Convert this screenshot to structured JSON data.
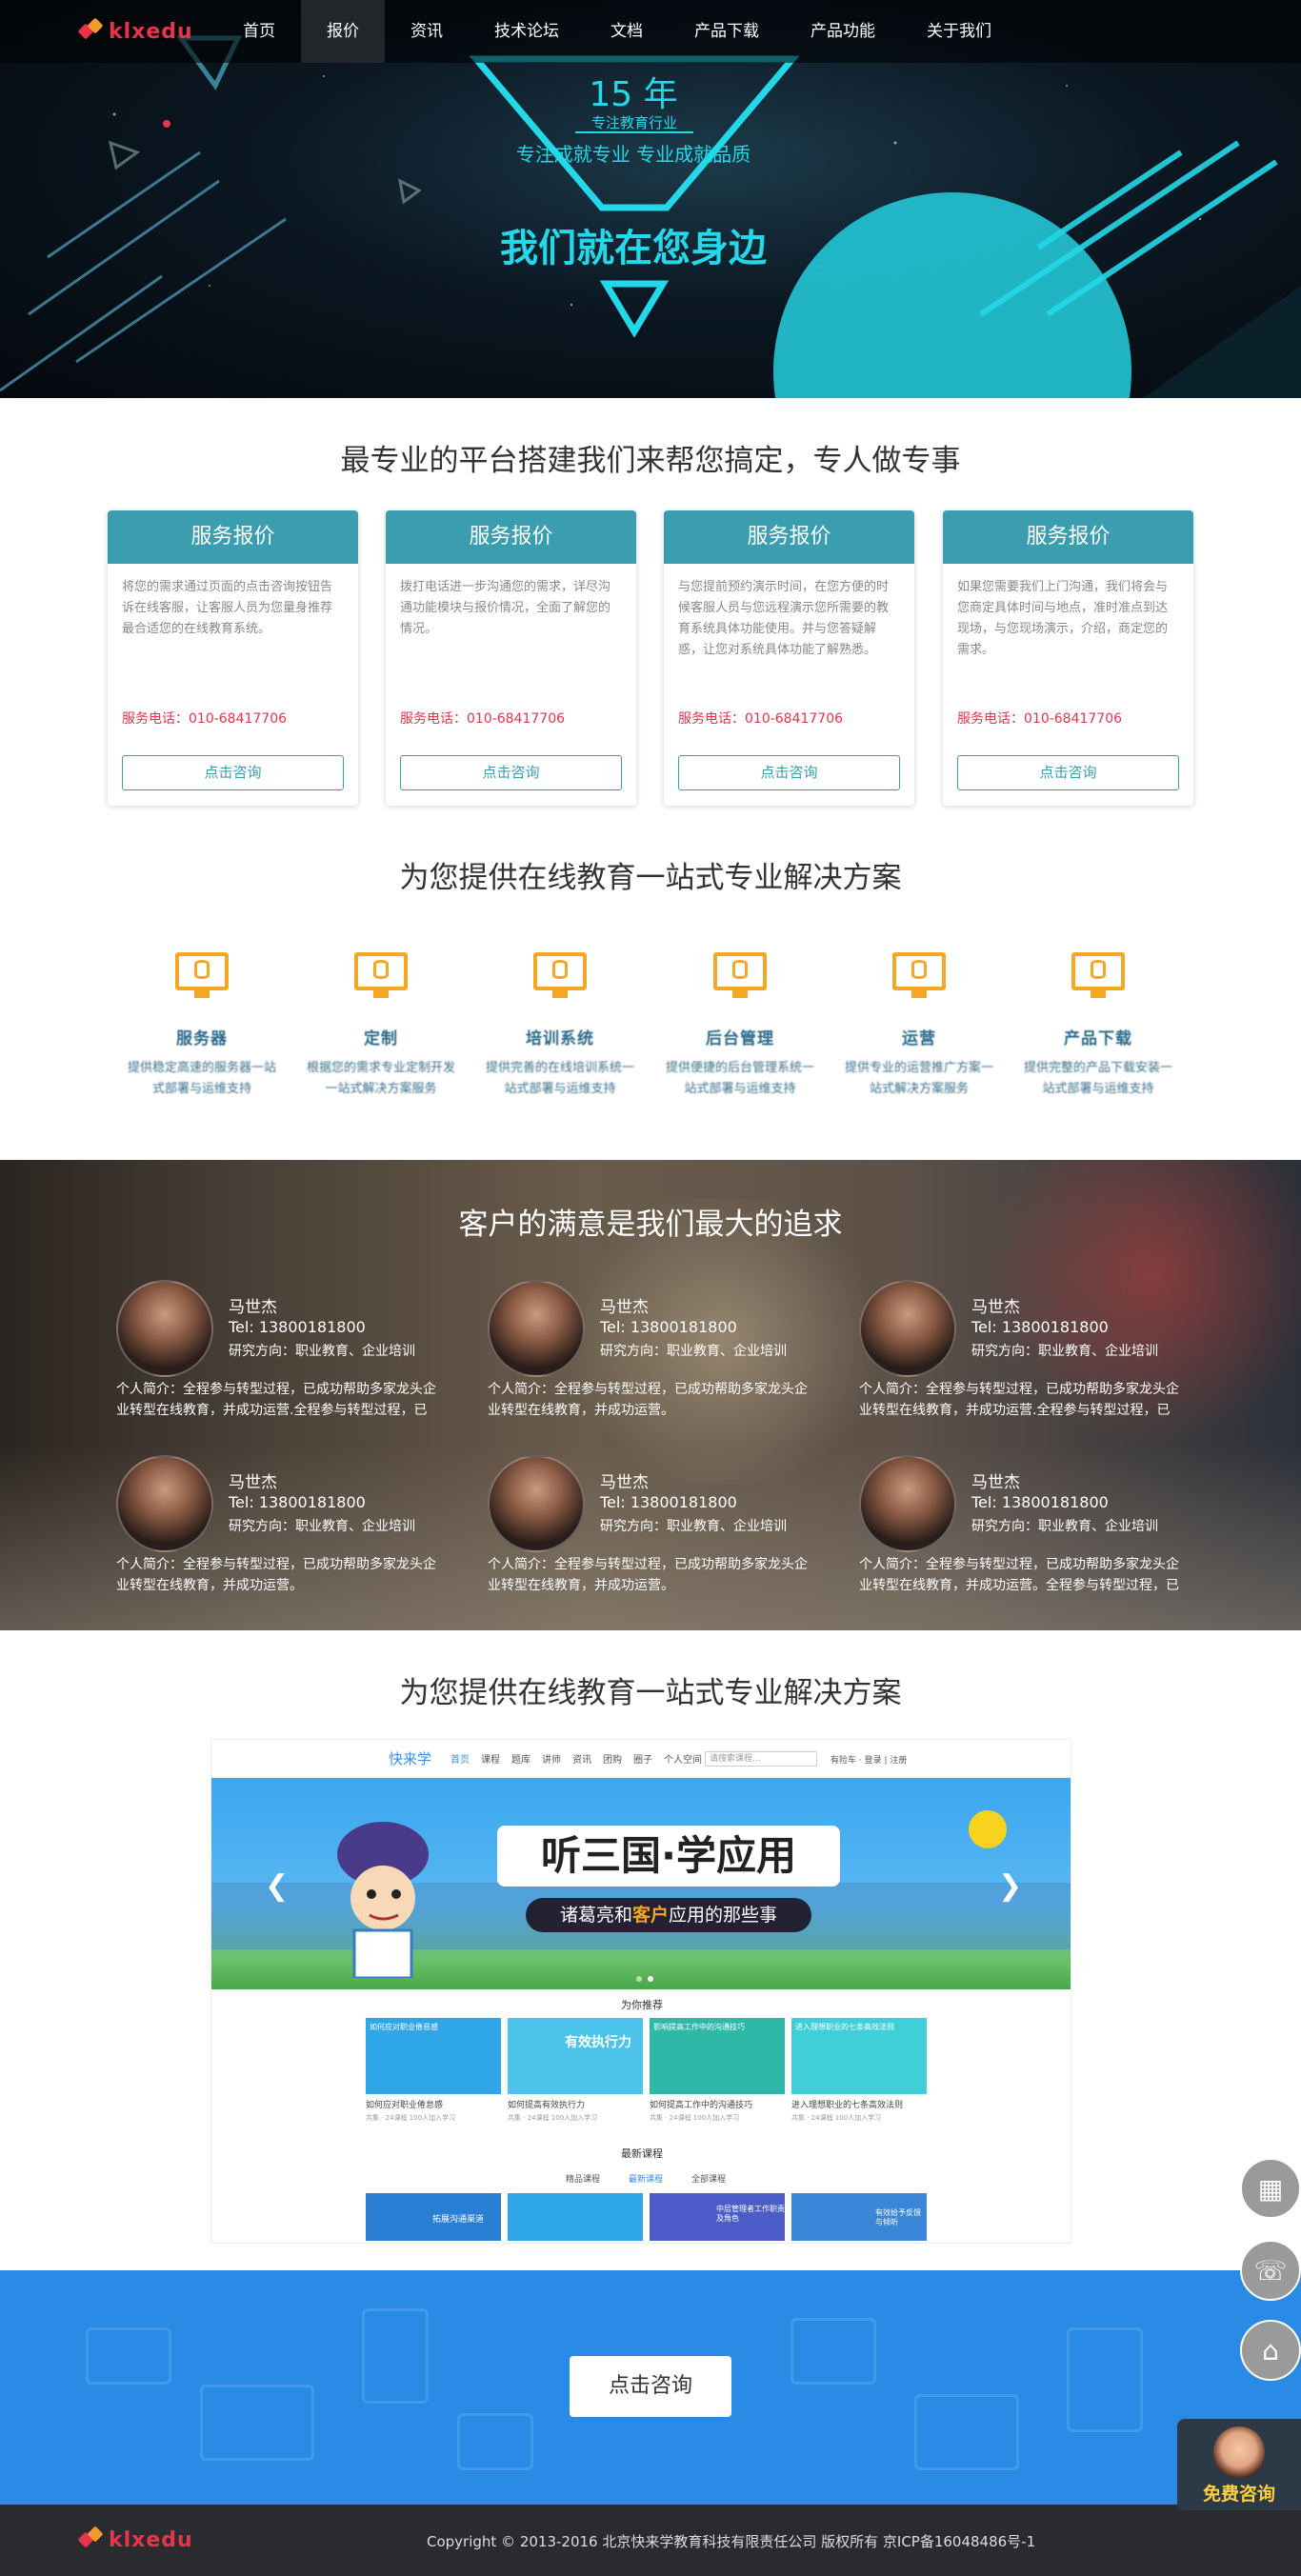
{
  "nav": {
    "logo_text": "klxedu",
    "items": [
      {
        "label": "首页",
        "active": false
      },
      {
        "label": "报价",
        "active": true
      },
      {
        "label": "资讯",
        "active": false
      },
      {
        "label": "技术论坛",
        "active": false
      },
      {
        "label": "文档",
        "active": false
      },
      {
        "label": "产品下载",
        "active": false
      },
      {
        "label": "产品功能",
        "active": false
      },
      {
        "label": "关于我们",
        "active": false
      }
    ]
  },
  "hero": {
    "years": "15 年",
    "tagline_small": "专注教育行业",
    "tagline_mid": "专注成就专业  专业成就品质",
    "slogan": "我们就在您身边"
  },
  "quote_section": {
    "title": "最专业的平台搭建我们来帮您搞定，专人做专事",
    "cards": [
      {
        "head": "服务报价",
        "desc": "将您的需求通过页面的点击咨询按钮告诉在线客服，让客服人员为您量身推荐最合适您的在线教育系统。",
        "phone": "服务电话：010-68417706",
        "button": "点击咨询"
      },
      {
        "head": "服务报价",
        "desc": "拨打电话进一步沟通您的需求，详尽沟通功能模块与报价情况，全面了解您的情况。",
        "phone": "服务电话：010-68417706",
        "button": "点击咨询"
      },
      {
        "head": "服务报价",
        "desc": "与您提前预约演示时间，在您方便的时候客服人员与您远程演示您所需要的教育系统具体功能使用。并与您答疑解惑，让您对系统具体功能了解熟悉。",
        "phone": "服务电话：010-68417706",
        "button": "点击咨询"
      },
      {
        "head": "服务报价",
        "desc": "如果您需要我们上门沟通，我们将会与您商定具体时间与地点，准时准点到达现场，与您现场演示，介绍，商定您的需求。",
        "phone": "服务电话：010-68417706",
        "button": "点击咨询"
      }
    ]
  },
  "solutions": {
    "title": "为您提供在线教育一站式专业解决方案",
    "features": [
      {
        "icon": "monitor-database-icon",
        "name": "服务器",
        "desc": "提供稳定高速的服务器一站式部署与运维支持"
      },
      {
        "icon": "monitor-database-icon",
        "name": "定制",
        "desc": "根据您的需求专业定制开发一站式解决方案服务"
      },
      {
        "icon": "monitor-database-icon",
        "name": "培训系统",
        "desc": "提供完善的在线培训系统一站式部署与运维支持"
      },
      {
        "icon": "monitor-database-icon",
        "name": "后台管理",
        "desc": "提供便捷的后台管理系统一站式部署与运维支持"
      },
      {
        "icon": "monitor-database-icon",
        "name": "运营",
        "desc": "提供专业的运营推广方案一站式解决方案服务"
      },
      {
        "icon": "monitor-database-icon",
        "name": "产品下载",
        "desc": "提供完整的产品下载安装一站式部署与运维支持"
      }
    ]
  },
  "testimonials": {
    "title": "客户的满意是我们最大的追求",
    "items": [
      {
        "name": "马世杰",
        "tel": "Tel: 13800181800",
        "direction": "研究方向：职业教育、企业培训",
        "bio": "个人简介：全程参与转型过程，已成功帮助多家龙头企业转型在线教育，并成功运营.全程参与转型过程，已成"
      },
      {
        "name": "马世杰",
        "tel": "Tel: 13800181800",
        "direction": "研究方向：职业教育、企业培训",
        "bio": "个人简介：全程参与转型过程，已成功帮助多家龙头企业转型在线教育，并成功运营。"
      },
      {
        "name": "马世杰",
        "tel": "Tel: 13800181800",
        "direction": "研究方向：职业教育、企业培训",
        "bio": "个人简介：全程参与转型过程，已成功帮助多家龙头企业转型在线教育，并成功运营.全程参与转型过程，已成"
      },
      {
        "name": "马世杰",
        "tel": "Tel: 13800181800",
        "direction": "研究方向：职业教育、企业培训",
        "bio": "个人简介：全程参与转型过程，已成功帮助多家龙头企业转型在线教育，并成功运营。"
      },
      {
        "name": "马世杰",
        "tel": "Tel: 13800181800",
        "direction": "研究方向：职业教育、企业培训",
        "bio": "个人简介：全程参与转型过程，已成功帮助多家龙头企业转型在线教育，并成功运营。"
      },
      {
        "name": "马世杰",
        "tel": "Tel: 13800181800",
        "direction": "研究方向：职业教育、企业培训",
        "bio": "个人简介：全程参与转型过程，已成功帮助多家龙头企业转型在线教育，并成功运营。全程参与转型过程，已"
      }
    ]
  },
  "showcase": {
    "title": "为您提供在线教育一站式专业解决方案",
    "site": {
      "brand": "快来学",
      "nav": [
        "首页",
        "课程",
        "题库",
        "讲师",
        "资讯",
        "团购",
        "圈子",
        "个人空间"
      ],
      "search_placeholder": "请搜索课程...",
      "user_links": "有险车  ·  登录 | 注册",
      "banner_title": "听三国·学应用",
      "banner_sub_pre": "诸葛亮和",
      "banner_sub_em": "客户",
      "banner_sub_post": "应用的那些事",
      "recommend_label": "为你推荐",
      "tiles": [
        {
          "label": "如何应对职业倦怠感",
          "meta": "共集 · 24课程    100人加入学习"
        },
        {
          "label": "如何提高有效执行力",
          "meta": "共集 · 24课程    100人加入学习"
        },
        {
          "label": "如何提高工作中的沟通技巧",
          "meta": "共集 · 24课程    100人加入学习"
        },
        {
          "label": "进入理想职业的七条高效法则",
          "meta": "共集 · 24课程    100人加入学习"
        }
      ],
      "tile_captions": [
        "如何应对职业倦怠感",
        "有效执行力",
        "影响提高工作中的沟通技巧",
        "进入理想职业的七条高效法则"
      ],
      "newest_label": "最新课程",
      "newest_tabs": [
        "精品课程",
        "最新课程",
        "全部课程"
      ],
      "new_tiles": [
        "拓展沟通渠道",
        "",
        "中层管理者工作职责及角色",
        "有效给予反馈与倾听"
      ]
    }
  },
  "cta": {
    "button": "点击咨询"
  },
  "footer": {
    "logo_text": "klxedu",
    "copyright": "Copyright © 2013-2016  北京快来学教育科技有限责任公司 版权所有     京ICP备16048486号-1"
  },
  "floating": {
    "qr_icon": "qr-code-icon",
    "service_icon": "customer-service-icon",
    "home_icon": "home-icon",
    "consult_label": "免费咨询"
  }
}
